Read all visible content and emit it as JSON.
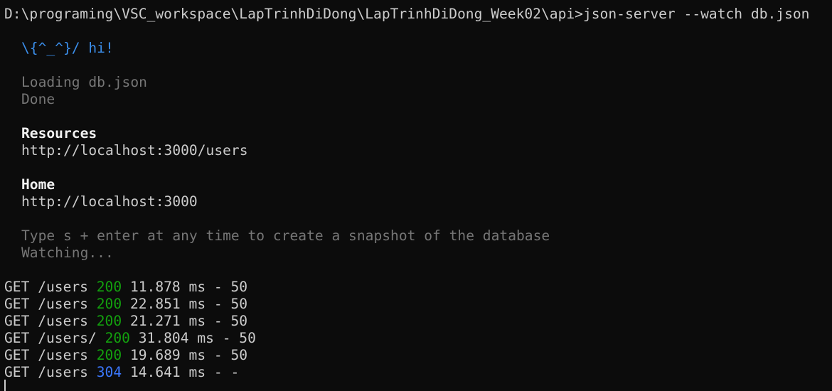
{
  "terminal": {
    "prompt_path": "D:\\programing\\VSC_workspace\\LapTrinhDiDong\\LapTrinhDiDong_Week02\\api>",
    "command": "json-server --watch db.json",
    "greeting": "\\{^_^}/ hi!",
    "loading": "Loading db.json",
    "done": "Done",
    "resources_heading": "Resources",
    "resources_url": "http://localhost:3000/users",
    "home_heading": "Home",
    "home_url": "http://localhost:3000",
    "snapshot_hint": "Type s + enter at any time to create a snapshot of the database",
    "watching": "Watching...",
    "requests": [
      {
        "method": "GET",
        "path": "/users",
        "status": "200",
        "time": "11.878 ms - 50"
      },
      {
        "method": "GET",
        "path": "/users",
        "status": "200",
        "time": "22.851 ms - 50"
      },
      {
        "method": "GET",
        "path": "/users",
        "status": "200",
        "time": "21.271 ms - 50"
      },
      {
        "method": "GET",
        "path": "/users/",
        "status": "200",
        "time": "31.804 ms - 50"
      },
      {
        "method": "GET",
        "path": "/users",
        "status": "200",
        "time": "19.689 ms - 50"
      },
      {
        "method": "GET",
        "path": "/users",
        "status": "304",
        "time": "14.641 ms - -"
      }
    ]
  },
  "colors": {
    "background": "#0c0c0c",
    "text": "#cccccc",
    "accent_blue": "#3b8eea",
    "status_ok": "#13a10e",
    "status_not_modified": "#3b78ff",
    "dim": "#767676"
  }
}
